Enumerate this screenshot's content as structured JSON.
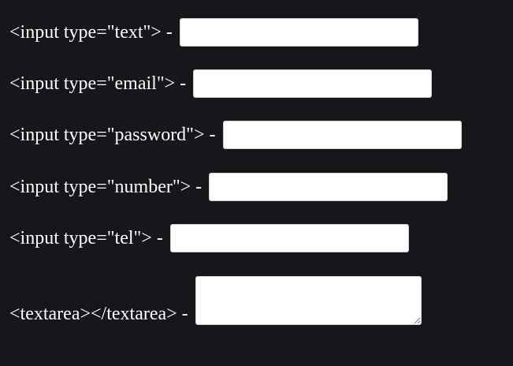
{
  "rows": [
    {
      "label": "<input type=\"text\"> -",
      "type": "text",
      "value": ""
    },
    {
      "label": "<input type=\"email\"> -",
      "type": "email",
      "value": ""
    },
    {
      "label": "<input type=\"password\"> -",
      "type": "password",
      "value": ""
    },
    {
      "label": "<input type=\"number\"> -",
      "type": "number",
      "value": ""
    },
    {
      "label": "<input type=\"tel\"> -",
      "type": "tel",
      "value": ""
    }
  ],
  "textarea": {
    "label": "<textarea></textarea> -",
    "value": ""
  },
  "colors": {
    "background": "#16171b",
    "text": "#ffffff",
    "field": "#ffffff"
  }
}
